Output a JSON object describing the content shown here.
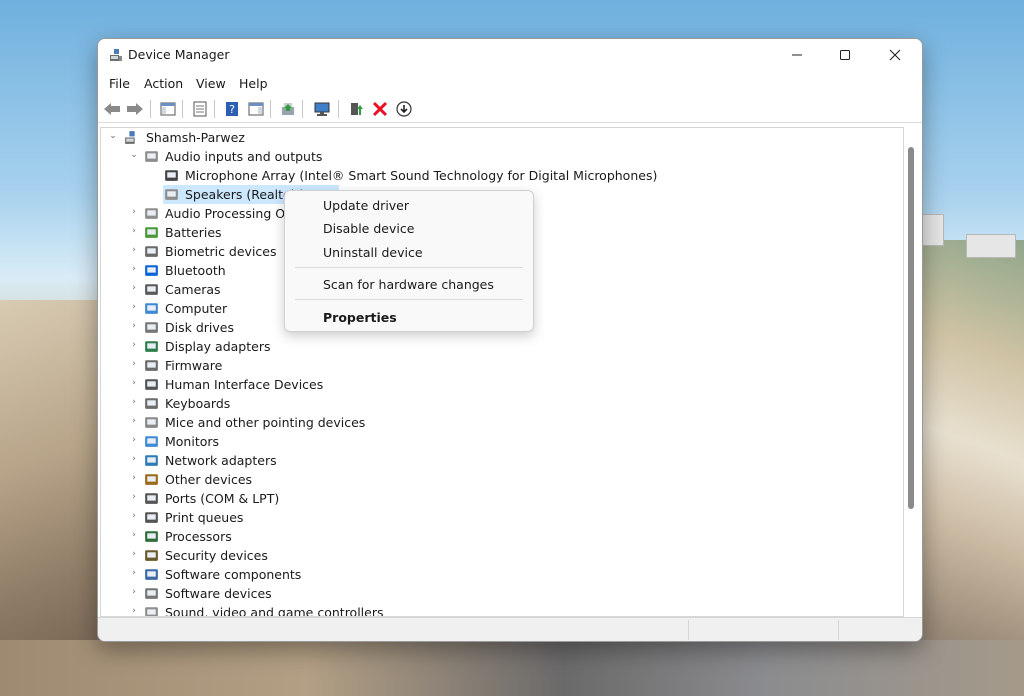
{
  "window": {
    "title": "Device Manager"
  },
  "menu": [
    "File",
    "Action",
    "View",
    "Help"
  ],
  "toolbar": [
    "back-arrow-icon",
    "forward-arrow-icon",
    "show-hide-console-tree-icon",
    "properties-icon",
    "help-icon",
    "action-pane-icon",
    "update-driver-icon",
    "scan-hardware-icon",
    "enable-device-icon",
    "uninstall-device-icon",
    "disable-device-icon"
  ],
  "tree": {
    "root": "Shamsh-Parwez",
    "items": [
      {
        "label": "Audio inputs and outputs",
        "icon": "speaker-icon"
      },
      {
        "label": "Microphone Array (Intel® Smart Sound Technology for Digital Microphones)",
        "icon": "microphone-icon"
      },
      {
        "label": "Speakers (Realtek(",
        "icon": "speaker-icon"
      },
      {
        "label": "Audio Processing Obj",
        "icon": "speaker-icon"
      },
      {
        "label": "Batteries",
        "icon": "battery-icon"
      },
      {
        "label": "Biometric devices",
        "icon": "fingerprint-icon"
      },
      {
        "label": "Bluetooth",
        "icon": "bluetooth-icon"
      },
      {
        "label": "Cameras",
        "icon": "camera-icon"
      },
      {
        "label": "Computer",
        "icon": "computer-icon"
      },
      {
        "label": "Disk drives",
        "icon": "disk-drive-icon"
      },
      {
        "label": "Display adapters",
        "icon": "display-adapter-icon"
      },
      {
        "label": "Firmware",
        "icon": "firmware-icon"
      },
      {
        "label": "Human Interface Devices",
        "icon": "hid-icon"
      },
      {
        "label": "Keyboards",
        "icon": "keyboard-icon"
      },
      {
        "label": "Mice and other pointing devices",
        "icon": "mouse-icon"
      },
      {
        "label": "Monitors",
        "icon": "monitor-icon"
      },
      {
        "label": "Network adapters",
        "icon": "network-adapter-icon"
      },
      {
        "label": "Other devices",
        "icon": "other-devices-icon"
      },
      {
        "label": "Ports (COM & LPT)",
        "icon": "port-icon"
      },
      {
        "label": "Print queues",
        "icon": "printer-icon"
      },
      {
        "label": "Processors",
        "icon": "processor-icon"
      },
      {
        "label": "Security devices",
        "icon": "security-device-icon"
      },
      {
        "label": "Software components",
        "icon": "software-component-icon"
      },
      {
        "label": "Software devices",
        "icon": "software-device-icon"
      },
      {
        "label": "Sound, video and game controllers",
        "icon": "sound-controller-icon"
      }
    ]
  },
  "context_menu": {
    "update_driver": "Update driver",
    "disable_device": "Disable device",
    "uninstall_device": "Uninstall device",
    "scan": "Scan for hardware changes",
    "properties": "Properties"
  },
  "colors": {
    "selection": "#cce8ff",
    "accent": "#0078d4",
    "delete_red": "#e81123"
  }
}
